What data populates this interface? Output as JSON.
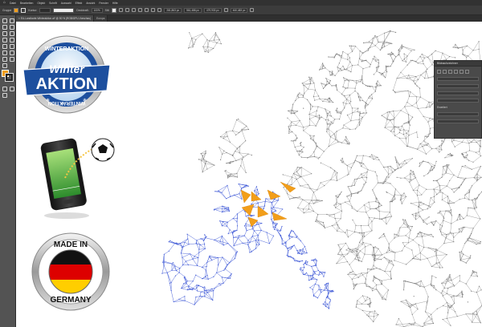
{
  "menubar": {
    "items": [
      "Datei",
      "Bearbeiten",
      "Objekt",
      "Schrift",
      "Auswahl",
      "Effekt",
      "Ansicht",
      "Fenster",
      "Hilfe"
    ]
  },
  "controlbar": {
    "group_label": "Gruppe",
    "stroke_label": "Kontur:",
    "opacity_label": "Deckkraft:",
    "opacity_value": "100%",
    "style_label": "Stil:",
    "x_value": "281,863 px",
    "y_value": "561,486 px",
    "w_value": "479,933 px",
    "h_value": "460,483 px"
  },
  "tabs": [
    {
      "label": "× EU-Landkarte-Winteraktion.ai* @ 50 % (RGB/GPU-Vorschau)"
    },
    {
      "label": "Europa"
    }
  ],
  "panel": {
    "title": "Bildnachzeichner",
    "section": "Erweitert"
  },
  "badges": {
    "winter_top": "WINTERAKTION",
    "winter_main_1": "Winter",
    "winter_main_2": "AKTION",
    "winter_bottom": "WINTERAKTION",
    "made_top": "MADE IN",
    "made_bottom": "GERMANY"
  },
  "colors": {
    "accent_orange": "#f29e1a",
    "network_blue": "#3b56d6",
    "network_gray": "#7a7a7a",
    "badge_blue": "#1d4f9e"
  }
}
